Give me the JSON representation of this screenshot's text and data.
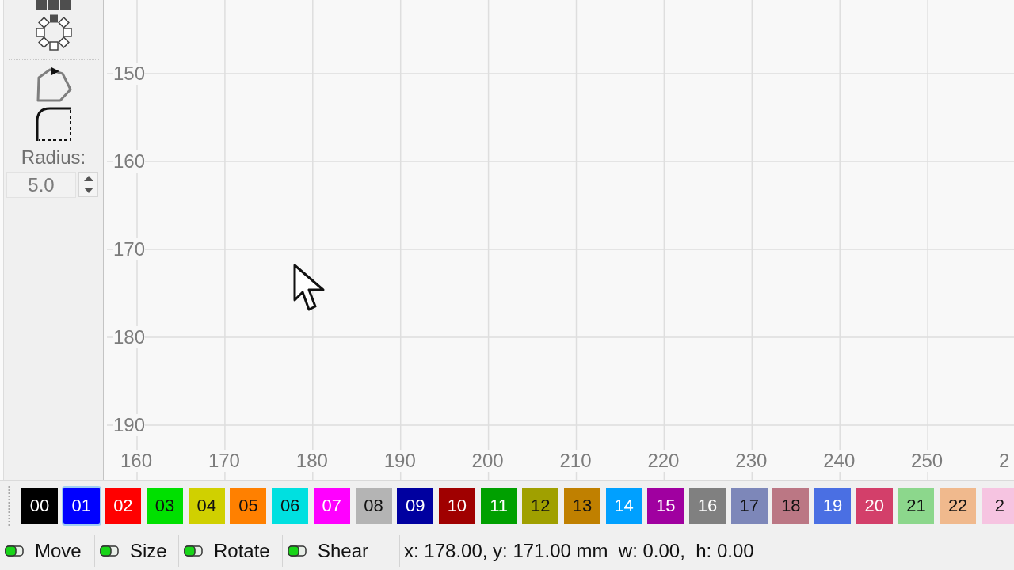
{
  "toolbar": {
    "radius_label": "Radius:",
    "radius_value": "5.0"
  },
  "canvas": {
    "y_labels": [
      "150",
      "160",
      "170",
      "180",
      "190"
    ],
    "x_labels": [
      "160",
      "170",
      "180",
      "190",
      "200",
      "210",
      "220",
      "230",
      "240",
      "250",
      "2"
    ]
  },
  "palette": [
    {
      "label": "00",
      "color": "#000000",
      "selected": false
    },
    {
      "label": "01",
      "color": "#0000ff",
      "selected": true
    },
    {
      "label": "02",
      "color": "#ff0000",
      "selected": false
    },
    {
      "label": "03",
      "color": "#00e000",
      "selected": false
    },
    {
      "label": "04",
      "color": "#d0d000",
      "selected": false
    },
    {
      "label": "05",
      "color": "#ff8000",
      "selected": false
    },
    {
      "label": "06",
      "color": "#00e0e0",
      "selected": false
    },
    {
      "label": "07",
      "color": "#ff00ff",
      "selected": false
    },
    {
      "label": "08",
      "color": "#b4b4b4",
      "selected": false
    },
    {
      "label": "09",
      "color": "#0000a0",
      "selected": false
    },
    {
      "label": "10",
      "color": "#a00000",
      "selected": false
    },
    {
      "label": "11",
      "color": "#00a000",
      "selected": false
    },
    {
      "label": "12",
      "color": "#a0a000",
      "selected": false
    },
    {
      "label": "13",
      "color": "#c08000",
      "selected": false
    },
    {
      "label": "14",
      "color": "#00a0ff",
      "selected": false
    },
    {
      "label": "15",
      "color": "#a000a0",
      "selected": false
    },
    {
      "label": "16",
      "color": "#808080",
      "selected": false
    },
    {
      "label": "17",
      "color": "#7d87b9",
      "selected": false
    },
    {
      "label": "18",
      "color": "#bb7784",
      "selected": false
    },
    {
      "label": "19",
      "color": "#4a6fe3",
      "selected": false
    },
    {
      "label": "20",
      "color": "#d33f6a",
      "selected": false
    },
    {
      "label": "21",
      "color": "#8cd78c",
      "selected": false
    },
    {
      "label": "22",
      "color": "#f0b98d",
      "selected": false
    },
    {
      "label": "2",
      "color": "#f6c4e1",
      "selected": false
    }
  ],
  "status_bar": {
    "toggles": [
      {
        "label": "Move",
        "on": true
      },
      {
        "label": "Size",
        "on": true
      },
      {
        "label": "Rotate",
        "on": true
      },
      {
        "label": "Shear",
        "on": true
      }
    ],
    "readout": "x: 178.00, y: 171.00 mm  w: 0.00,  h: 0.00"
  }
}
